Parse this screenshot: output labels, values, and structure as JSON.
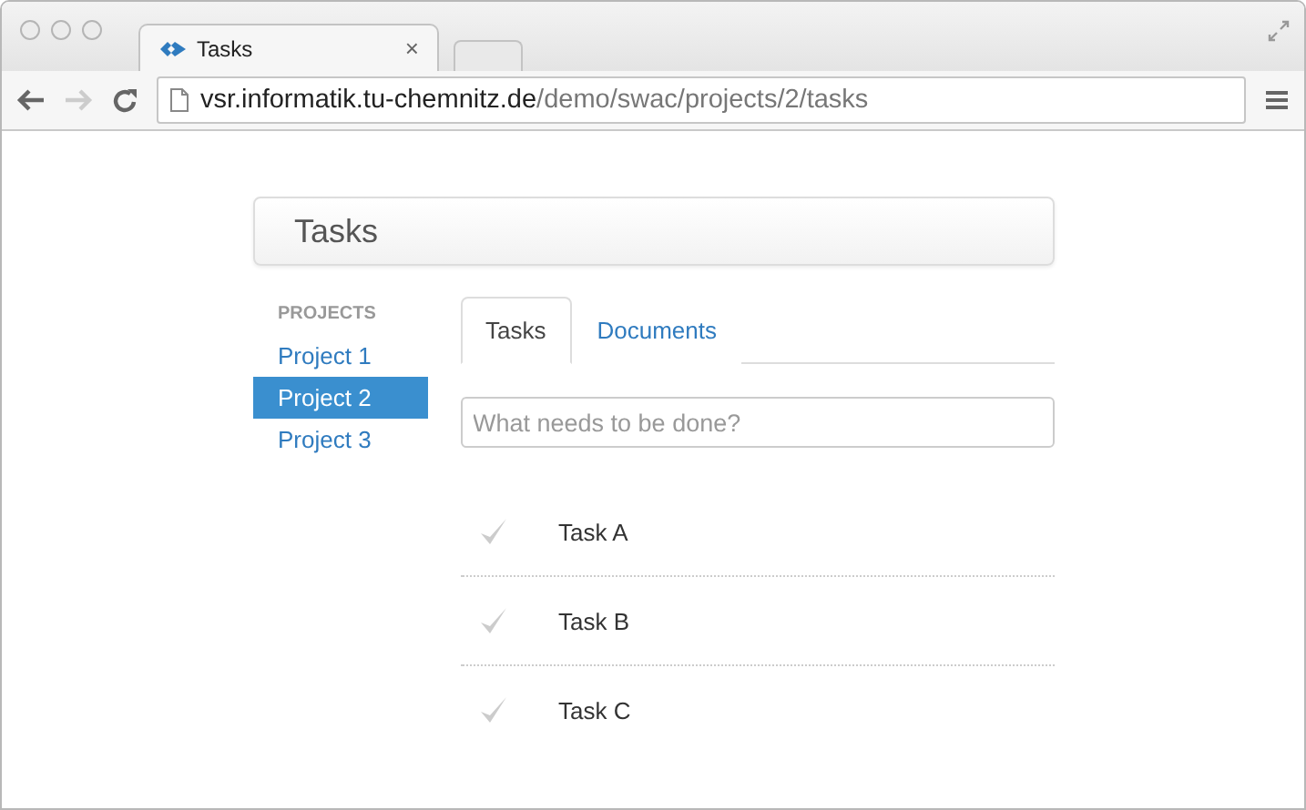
{
  "browser": {
    "tab_title": "Tasks",
    "tab_close": "×",
    "url": {
      "host": "vsr.informatik.tu-chemnitz.de",
      "path": "/demo/swac/projects/2/tasks"
    }
  },
  "page": {
    "title": "Tasks",
    "sidebar": {
      "heading": "PROJECTS",
      "items": [
        {
          "label": "Project 1",
          "selected": false
        },
        {
          "label": "Project 2",
          "selected": true
        },
        {
          "label": "Project 3",
          "selected": false
        }
      ]
    },
    "tabs": [
      {
        "label": "Tasks",
        "selected": true
      },
      {
        "label": "Documents",
        "selected": false
      }
    ],
    "new_task": {
      "placeholder": "What needs to be done?"
    },
    "tasks": [
      {
        "title": "Task A",
        "done": false
      },
      {
        "title": "Task B",
        "done": false
      },
      {
        "title": "Task C",
        "done": false
      }
    ]
  }
}
